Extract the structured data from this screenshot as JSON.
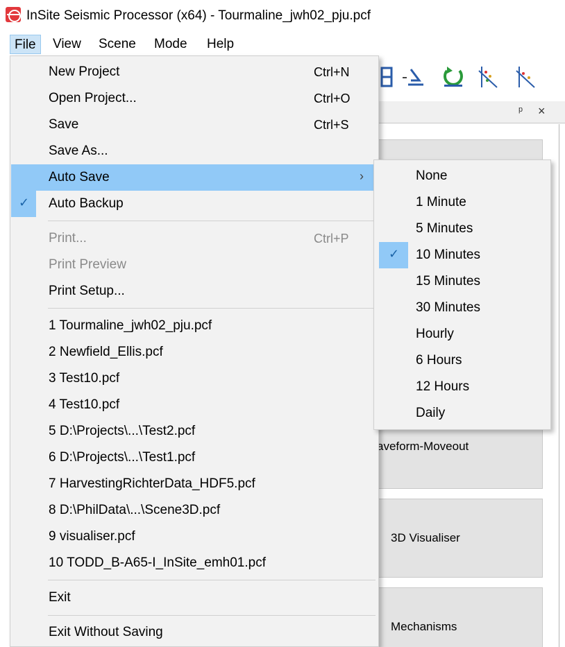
{
  "window": {
    "title": "InSite Seismic Processor (x64) - Tourmaline_jwh02_pju.pcf"
  },
  "menubar": {
    "items": [
      "File",
      "View",
      "Scene",
      "Mode",
      "Help"
    ]
  },
  "file_menu": {
    "new_project": {
      "label": "New Project",
      "shortcut": "Ctrl+N"
    },
    "open_project": {
      "label": "Open Project...",
      "shortcut": "Ctrl+O"
    },
    "save": {
      "label": "Save",
      "shortcut": "Ctrl+S"
    },
    "save_as": {
      "label": "Save As..."
    },
    "auto_save": {
      "label": "Auto Save",
      "arrow": "›"
    },
    "auto_backup": {
      "label": "Auto Backup",
      "checked": true,
      "check_glyph": "✓"
    },
    "print": {
      "label": "Print...",
      "shortcut": "Ctrl+P",
      "disabled": true
    },
    "print_preview": {
      "label": "Print Preview",
      "disabled": true
    },
    "print_setup": {
      "label": "Print Setup..."
    },
    "recent": [
      "1 Tourmaline_jwh02_pju.pcf",
      "2 Newfield_Ellis.pcf",
      "3 Test10.pcf",
      "4 Test10.pcf",
      "5 D:\\Projects\\...\\Test2.pcf",
      "6 D:\\Projects\\...\\Test1.pcf",
      "7 HarvestingRichterData_HDF5.pcf",
      "8 D:\\PhilData\\...\\Scene3D.pcf",
      "9 visualiser.pcf",
      "10 TODD_B-A65-I_InSite_emh01.pcf"
    ],
    "exit": {
      "label": "Exit"
    },
    "exit_without_saving": {
      "label": "Exit Without Saving"
    }
  },
  "auto_save_menu": {
    "check_glyph": "✓",
    "selected": "10 Minutes",
    "items": [
      "None",
      "1 Minute",
      "5 Minutes",
      "10 Minutes",
      "15 Minutes",
      "30 Minutes",
      "Hourly",
      "6 Hours",
      "12 Hours",
      "Daily"
    ]
  },
  "panel": {
    "pin_glyph": "ᵖ",
    "close_glyph": "×",
    "tiles": [
      "aveform-Moveout",
      "3D Visualiser",
      "Mechanisms"
    ]
  },
  "colors": {
    "highlight": "#91c9f7",
    "menu_bg": "#f2f2f2",
    "check": "#1a63a8",
    "disabled_text": "#8a8a8a"
  }
}
